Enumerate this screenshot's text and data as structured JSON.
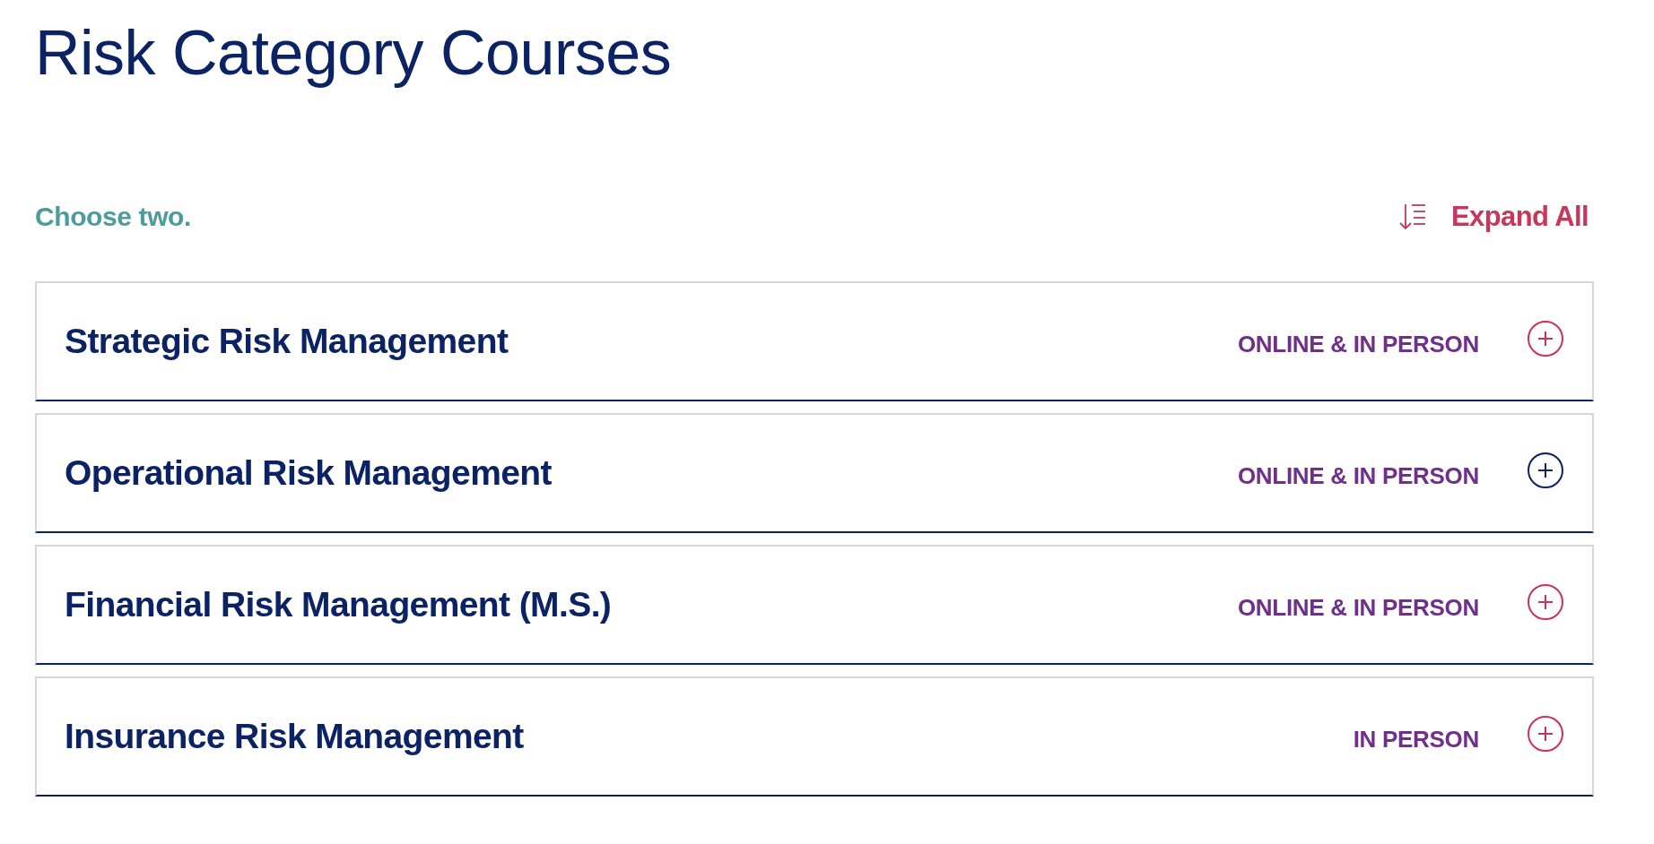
{
  "page": {
    "title": "Risk Category Courses"
  },
  "instruction": "Choose two.",
  "expand_all": {
    "label": "Expand All"
  },
  "courses": [
    {
      "title": "Strategic Risk Management",
      "format": "ONLINE & IN PERSON",
      "expanded": false,
      "hovered": false
    },
    {
      "title": "Operational Risk Management",
      "format": "ONLINE & IN PERSON",
      "expanded": false,
      "hovered": true
    },
    {
      "title": "Financial Risk Management (M.S.)",
      "format": "ONLINE & IN PERSON",
      "expanded": false,
      "hovered": false
    },
    {
      "title": "Insurance Risk Management",
      "format": "IN PERSON",
      "expanded": false,
      "hovered": false
    }
  ]
}
